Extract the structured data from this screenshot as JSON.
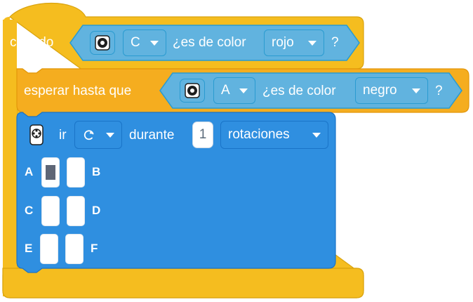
{
  "colors": {
    "event_yellow": "#f5bd1f",
    "sensor_blue": "#61b3df",
    "motor_blue": "#2f8fe0"
  },
  "when_block": {
    "label": "cuando",
    "sensor_icon": "color-sensor-icon",
    "port_value": "C",
    "condition_text": "¿es de color",
    "color_value": "rojo",
    "suffix": "?"
  },
  "wait_block": {
    "label": "esperar hasta que",
    "sensor_icon": "color-sensor-icon",
    "port_value": "A",
    "condition_text": "¿es de color",
    "color_value": "negro",
    "suffix": "?"
  },
  "motor_block": {
    "pair_icon": "motor-pair-icon",
    "label_go": "ir",
    "direction_icon": "clockwise-arrow-icon",
    "label_for": "durante",
    "amount_value": "1",
    "unit_value": "rotaciones"
  },
  "port_selector": {
    "ports": [
      {
        "left": "A",
        "right": "B",
        "left_selected": true
      },
      {
        "left": "C",
        "right": "D",
        "left_selected": false
      },
      {
        "left": "E",
        "right": "F",
        "left_selected": false
      }
    ]
  }
}
